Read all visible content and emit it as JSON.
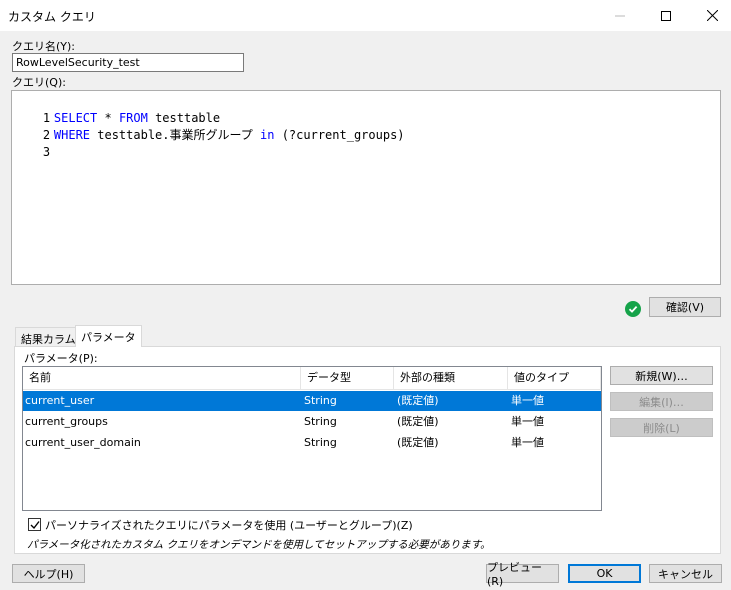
{
  "window": {
    "title": "カスタム クエリ",
    "min_icon": "minimize-icon",
    "max_icon": "maximize-icon",
    "close_icon": "close-icon"
  },
  "query_name": {
    "label": "クエリ名(Y):",
    "value": "RowLevelSecurity_test"
  },
  "query": {
    "label": "クエリ(Q):",
    "lines": [
      {
        "num": "1",
        "kw1": "SELECT",
        "t1": " * ",
        "kw2": "FROM",
        "t2": " testtable"
      },
      {
        "num": "2",
        "kw1": "WHERE",
        "t1": " testtable.事業所グループ ",
        "kw2": "in",
        "t2": " (?current_groups)"
      },
      {
        "num": "3",
        "kw1": "",
        "t1": "",
        "kw2": "",
        "t2": ""
      }
    ]
  },
  "verify": {
    "status_icon": "check-circle-icon",
    "status_color": "#16a34a",
    "button_label": "確認(V)"
  },
  "tabs": [
    {
      "label": "結果カラム",
      "active": false
    },
    {
      "label": "パラメータ",
      "active": true
    }
  ],
  "parameters": {
    "label": "パラメータ(P):",
    "columns": [
      "名前",
      "データ型",
      "外部の種類",
      "値のタイプ"
    ],
    "rows": [
      {
        "name": "current_user",
        "type": "String",
        "ext": "(既定値)",
        "val": "単一値",
        "selected": true
      },
      {
        "name": "current_groups",
        "type": "String",
        "ext": "(既定値)",
        "val": "単一値",
        "selected": false
      },
      {
        "name": "current_user_domain",
        "type": "String",
        "ext": "(既定値)",
        "val": "単一値",
        "selected": false
      }
    ],
    "buttons": {
      "new": "新規(W)…",
      "edit": "編集(I)…",
      "delete": "削除(L)"
    },
    "personalize_checkbox": {
      "checked": true,
      "label": "パーソナライズされたクエリにパラメータを使用 (ユーザーとグループ)(Z)"
    },
    "note": "パラメータ化されたカスタム クエリをオンデマンドを使用してセットアップする必要があります。"
  },
  "footer": {
    "help": "ヘルプ(H)",
    "preview": "プレビュー(R)",
    "ok": "OK",
    "cancel": "キャンセル"
  },
  "colors": {
    "selection": "#0078d7",
    "keyword": "#0000ff",
    "default_button_border": "#0078d7"
  }
}
